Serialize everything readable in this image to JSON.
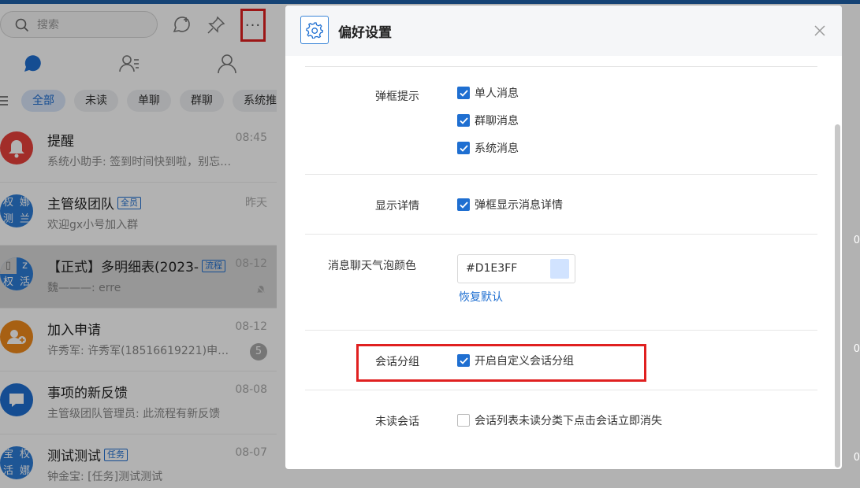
{
  "colors": {
    "accent": "#1f6fd1",
    "highlight": "#e02020",
    "bubble": "#D1E3FF"
  },
  "search": {
    "placeholder": "搜索"
  },
  "filters": [
    "全部",
    "未读",
    "单聊",
    "群聊",
    "系统推"
  ],
  "conversations": [
    {
      "name": "提醒",
      "tag": "",
      "time": "08:45",
      "preview": "系统小助手: 签到时间快到啦，别忘了打卡",
      "badge": ""
    },
    {
      "name": "主管级团队",
      "tag": "全员",
      "time": "昨天",
      "preview": "欢迎gx小号加入群",
      "badge": ""
    },
    {
      "name": "【正式】多明细表(2023-",
      "tag": "流程",
      "time": "08-12",
      "preview": "魏———: erre",
      "badge": ""
    },
    {
      "name": "加入申请",
      "tag": "",
      "time": "08-12",
      "preview": "许秀军: 许秀军(18516619221)申请加入",
      "badge": "5"
    },
    {
      "name": "事项的新反馈",
      "tag": "",
      "time": "08-08",
      "preview": "主管级团队管理员: 此流程有新反馈",
      "badge": ""
    },
    {
      "name": "测试测试",
      "tag": "任务",
      "time": "08-07",
      "preview": "钟金宝: [任务]测试测试",
      "badge": ""
    }
  ],
  "avatar_text": {
    "group": [
      "权",
      "娜",
      "测",
      "兰"
    ],
    "flow": [
      "z",
      "权",
      "活"
    ],
    "task": [
      "宝",
      "权",
      "活",
      "娜"
    ]
  },
  "dialog": {
    "title": "偏好设置",
    "popup_label": "弹框提示",
    "popup_options": [
      "单人消息",
      "群聊消息",
      "系统消息"
    ],
    "detail_label": "显示详情",
    "detail_option": "弹框显示消息详情",
    "bubble_label": "消息聊天气泡颜色",
    "bubble_value": "#D1E3FF",
    "reset": "恢复默认",
    "group_label": "会话分组",
    "group_option": "开启自定义会话分组",
    "unread_label": "未读会话",
    "unread_option": "会话列表未读分类下点击会话立即消失"
  },
  "right_edge": [
    "0",
    "0",
    "0"
  ]
}
